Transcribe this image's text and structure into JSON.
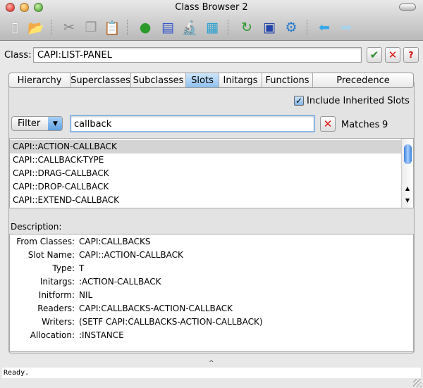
{
  "window": {
    "title": "Class Browser 2"
  },
  "toolbar": {
    "items": [
      "new-file",
      "open-file",
      "cut",
      "copy",
      "paste",
      "inspect-slots",
      "describe",
      "inspect-microscope",
      "hierarchy",
      "refresh",
      "new-window",
      "preferences",
      "back",
      "forward"
    ]
  },
  "class_row": {
    "label": "Class:",
    "value": "CAPI:LIST-PANEL",
    "ok": "✔",
    "cancel": "✕",
    "help": "?"
  },
  "tabs": [
    {
      "label": "Hierarchy"
    },
    {
      "label": "Superclasses"
    },
    {
      "label": "Subclasses"
    },
    {
      "label": "Slots",
      "selected": true
    },
    {
      "label": "Initargs"
    },
    {
      "label": "Functions"
    },
    {
      "label": "Precedence"
    }
  ],
  "slots": {
    "include_inherited_label": "Include Inherited Slots",
    "include_inherited": true,
    "filter_label": "Filter",
    "filter_value": "callback",
    "clear": "✕",
    "matches_label": "Matches",
    "matches": "9",
    "items": [
      "CAPI::ACTION-CALLBACK",
      "CAPI::CALLBACK-TYPE",
      "CAPI::DRAG-CALLBACK",
      "CAPI::DROP-CALLBACK",
      "CAPI::EXTEND-CALLBACK"
    ],
    "description_label": "Description:",
    "description": [
      {
        "k": "From Classes:",
        "v": "CAPI:CALLBACKS"
      },
      {
        "k": "Slot Name:",
        "v": "CAPI::ACTION-CALLBACK"
      },
      {
        "k": "Type:",
        "v": "T"
      },
      {
        "k": "Initargs:",
        "v": ":ACTION-CALLBACK"
      },
      {
        "k": "Initform:",
        "v": "NIL"
      },
      {
        "k": "Readers:",
        "v": "CAPI:CALLBACKS-ACTION-CALLBACK"
      },
      {
        "k": "Writers:",
        "v": "(SETF CAPI:CALLBACKS-ACTION-CALLBACK)"
      },
      {
        "k": "Allocation:",
        "v": ":INSTANCE"
      }
    ]
  },
  "status": {
    "text": "Ready."
  }
}
